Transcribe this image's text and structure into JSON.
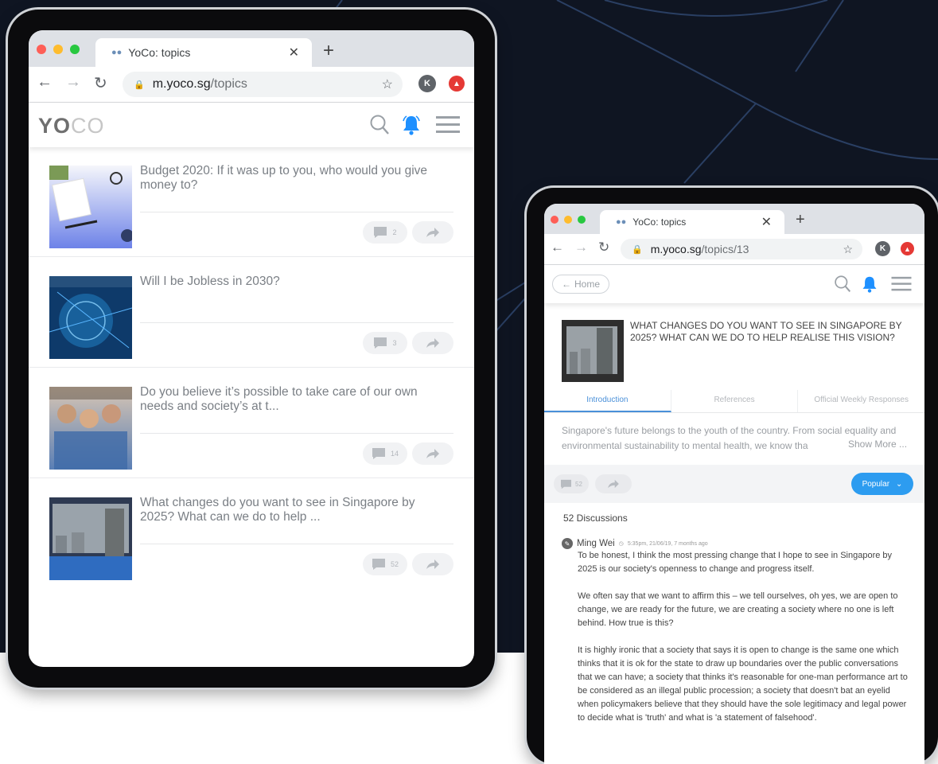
{
  "left_tablet": {
    "browser": {
      "tab_title": "YoCo: topics",
      "new_tab_label": "+",
      "url_host": "m.yoco.sg",
      "url_path": "/topics",
      "profile_initial": "K"
    },
    "app": {
      "logo_part1": "YO",
      "logo_part2": "CO"
    },
    "topics": [
      {
        "title": "Budget 2020: If it was up to you, who would you give money to?",
        "comments": "2"
      },
      {
        "title": "Will I be Jobless in 2030?",
        "comments": "3"
      },
      {
        "title": "Do you believe it’s possible to take care of our own needs and society’s at t...",
        "comments": "14"
      },
      {
        "title": "What changes do you want to see in Singapore by 2025? What can we do to help ...",
        "comments": "52"
      }
    ]
  },
  "right_tablet": {
    "browser": {
      "tab_title": "YoCo: topics",
      "new_tab_label": "+",
      "url_host": "m.yoco.sg",
      "url_path": "/topics/13",
      "profile_initial": "K"
    },
    "home_button_label": "Home",
    "topic_title": "WHAT CHANGES DO YOU WANT TO SEE IN SINGAPORE BY 2025? WHAT CAN WE DO TO HELP REALISE THIS VISION?",
    "tabs": [
      "Introduction",
      "References",
      "Official Weekly Responses"
    ],
    "active_tab": "Introduction",
    "intro_text": "Singapore's future belongs to the youth of the country. From social equality and environmental sustainability to mental health, we know tha",
    "show_more_label": "Show More ...",
    "comment_count": "52",
    "sort_label": "Popular",
    "discussions_label": "52 Discussions",
    "comment": {
      "author": "Ming Wei",
      "meta": "5:35pm, 21/06/19, 7 months ago",
      "paragraphs": [
        "To be honest, I think the most pressing change that I hope to see in Singapore by 2025 is our society's openness to change and progress itself.",
        "We often say that we want to affirm this – we tell ourselves, oh yes, we are open to change, we are ready for the future, we are creating a society where no one is left behind. How true is this?",
        "It is highly ironic that a society that says it is open to change is the same one which thinks that it is ok for the state to draw up boundaries over the public conversations that we can have; a society that thinks it's reasonable for one-man performance art to be considered as an illegal public procession; a society that doesn't bat an eyelid when policymakers believe that they should have the sole legitimacy and legal power to decide what is 'truth' and what is 'a statement of falsehood'."
      ]
    }
  },
  "colors": {
    "background_dark": "#0f1522",
    "accent_blue": "#2d9cf0",
    "bell_blue": "#1e90ff"
  }
}
